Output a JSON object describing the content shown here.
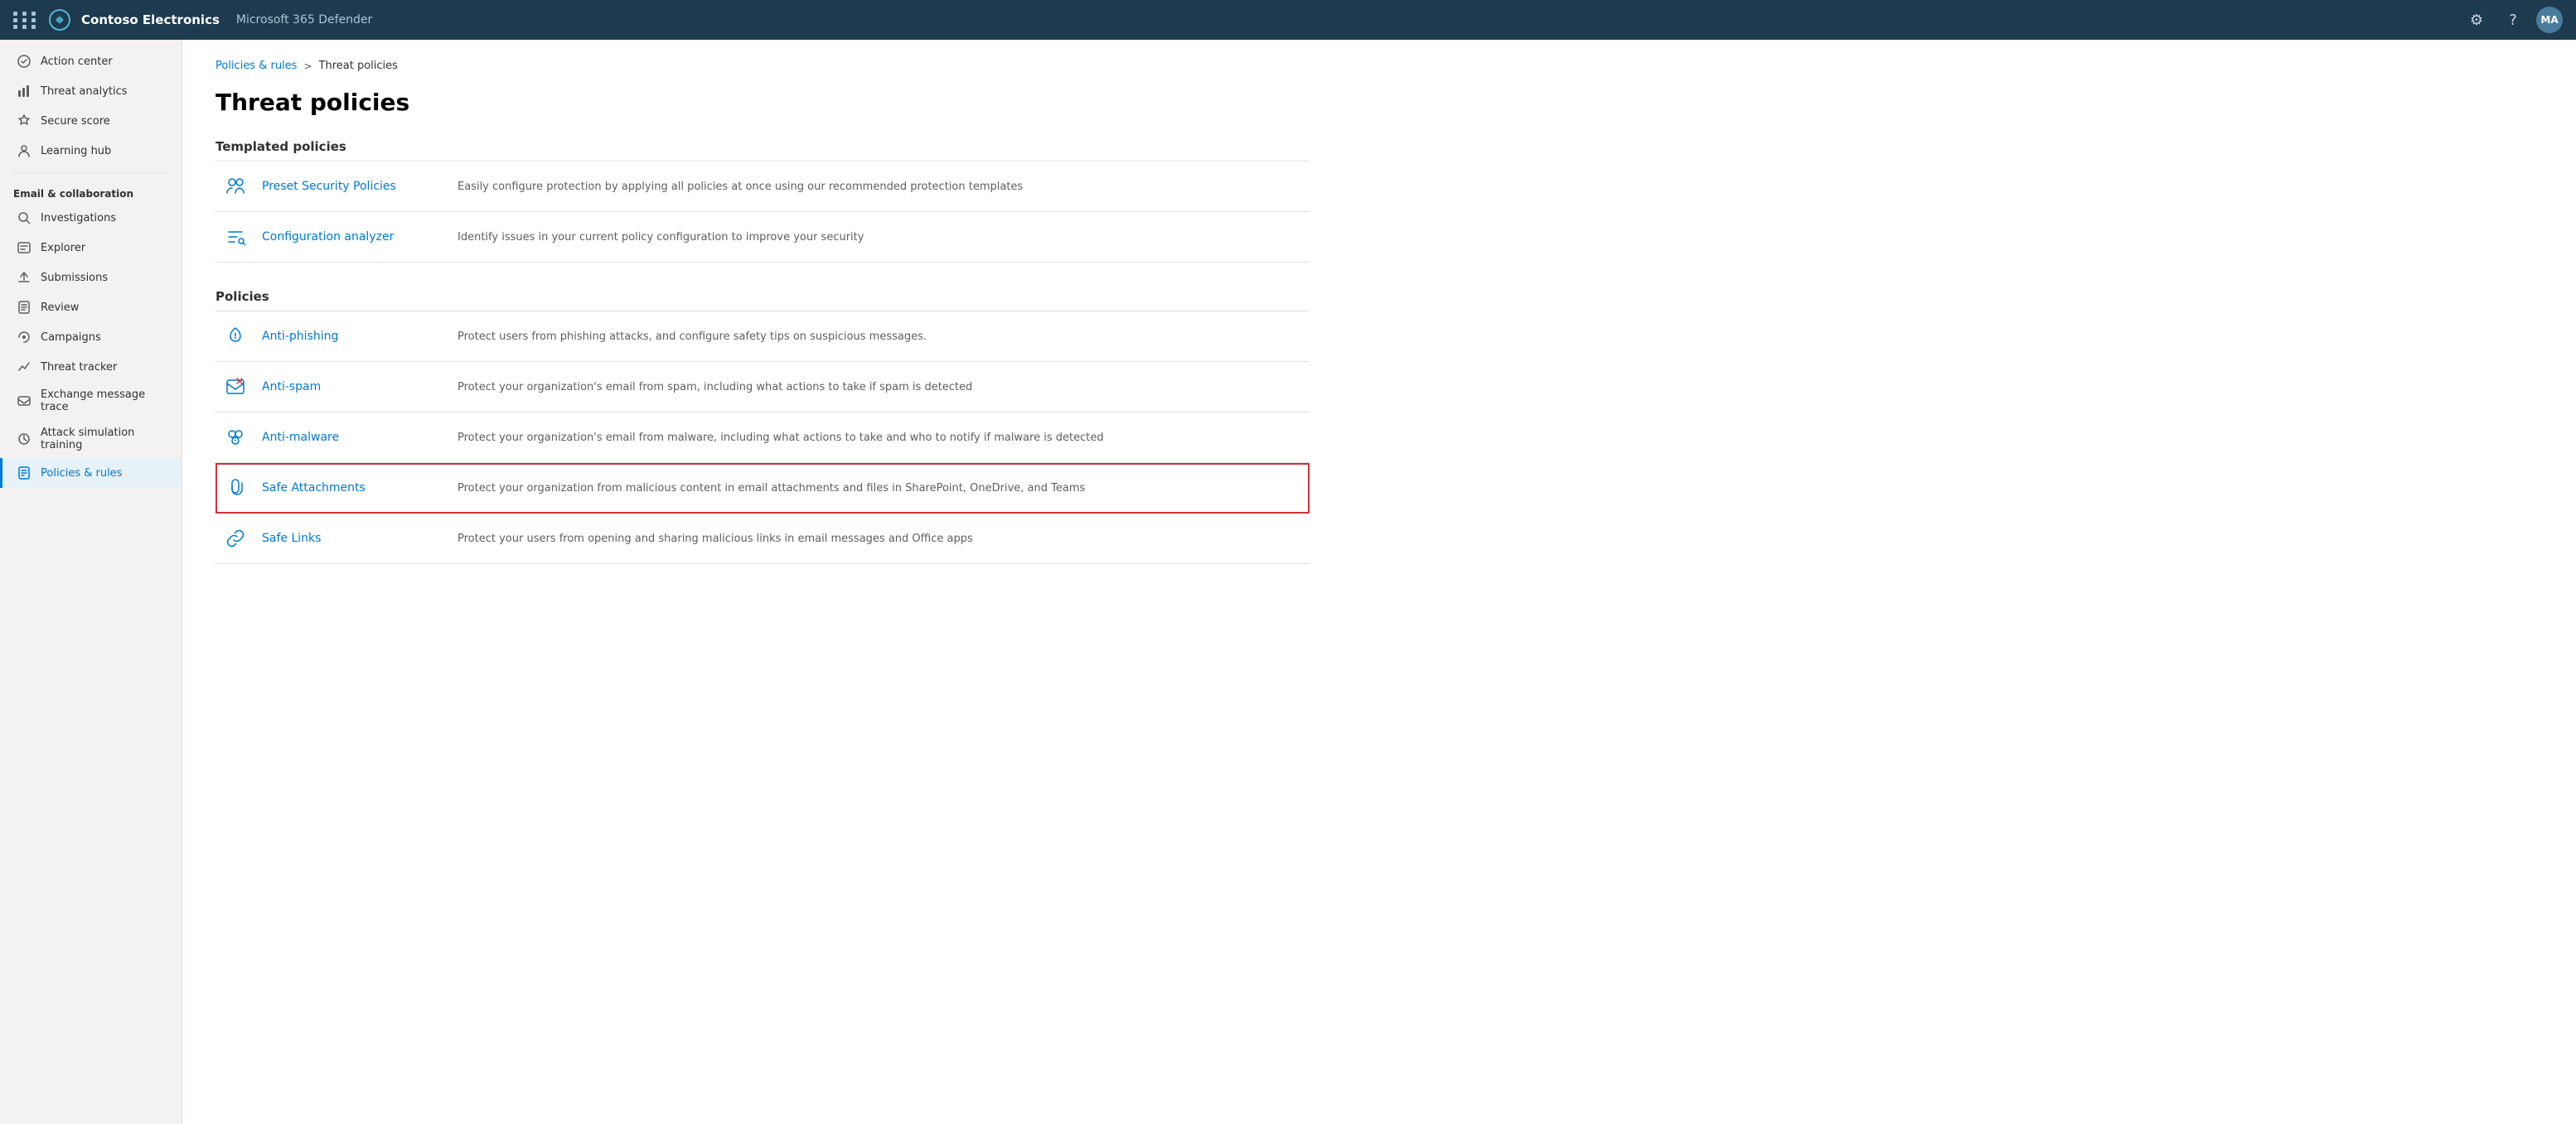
{
  "topbar": {
    "company": "Contoso Electronics",
    "app": "Microsoft 365 Defender",
    "avatar": "MA"
  },
  "sidebar": {
    "section_email": "Email & collaboration",
    "items_top": [
      {
        "id": "action-center",
        "label": "Action center",
        "icon": "↩"
      },
      {
        "id": "threat-analytics",
        "label": "Threat analytics",
        "icon": "📊"
      },
      {
        "id": "secure-score",
        "label": "Secure score",
        "icon": "🏆"
      },
      {
        "id": "learning-hub",
        "label": "Learning hub",
        "icon": "👤"
      }
    ],
    "items_email": [
      {
        "id": "investigations",
        "label": "Investigations",
        "icon": "🔍"
      },
      {
        "id": "explorer",
        "label": "Explorer",
        "icon": "📋"
      },
      {
        "id": "submissions",
        "label": "Submissions",
        "icon": "📤"
      },
      {
        "id": "review",
        "label": "Review",
        "icon": "📄"
      },
      {
        "id": "campaigns",
        "label": "Campaigns",
        "icon": "📢"
      },
      {
        "id": "threat-tracker",
        "label": "Threat tracker",
        "icon": "📈"
      },
      {
        "id": "exchange-message-trace",
        "label": "Exchange message trace",
        "icon": "📝"
      },
      {
        "id": "attack-simulation",
        "label": "Attack simulation training",
        "icon": "⚙"
      },
      {
        "id": "policies-rules",
        "label": "Policies & rules",
        "icon": "📋",
        "active": true
      }
    ]
  },
  "breadcrumb": {
    "link": "Policies & rules",
    "separator": ">",
    "current": "Threat policies"
  },
  "page": {
    "title": "Threat policies"
  },
  "templated_section": {
    "title": "Templated policies",
    "items": [
      {
        "id": "preset-security",
        "name": "Preset Security Policies",
        "description": "Easily configure protection by applying all policies at once using our recommended protection templates",
        "icon": "preset"
      },
      {
        "id": "config-analyzer",
        "name": "Configuration analyzer",
        "description": "Identify issues in your current policy configuration to improve your security",
        "icon": "analyzer"
      }
    ]
  },
  "policies_section": {
    "title": "Policies",
    "items": [
      {
        "id": "anti-phishing",
        "name": "Anti-phishing",
        "description": "Protect users from phishing attacks, and configure safety tips on suspicious messages.",
        "icon": "phishing",
        "highlighted": false
      },
      {
        "id": "anti-spam",
        "name": "Anti-spam",
        "description": "Protect your organization's email from spam, including what actions to take if spam is detected",
        "icon": "spam",
        "highlighted": false
      },
      {
        "id": "anti-malware",
        "name": "Anti-malware",
        "description": "Protect your organization's email from malware, including what actions to take and who to notify if malware is detected",
        "icon": "malware",
        "highlighted": false
      },
      {
        "id": "safe-attachments",
        "name": "Safe Attachments",
        "description": "Protect your organization from malicious content in email attachments and files in SharePoint, OneDrive, and Teams",
        "icon": "attachments",
        "highlighted": true
      },
      {
        "id": "safe-links",
        "name": "Safe Links",
        "description": "Protect your users from opening and sharing malicious links in email messages and Office apps",
        "icon": "links",
        "highlighted": false
      }
    ]
  }
}
